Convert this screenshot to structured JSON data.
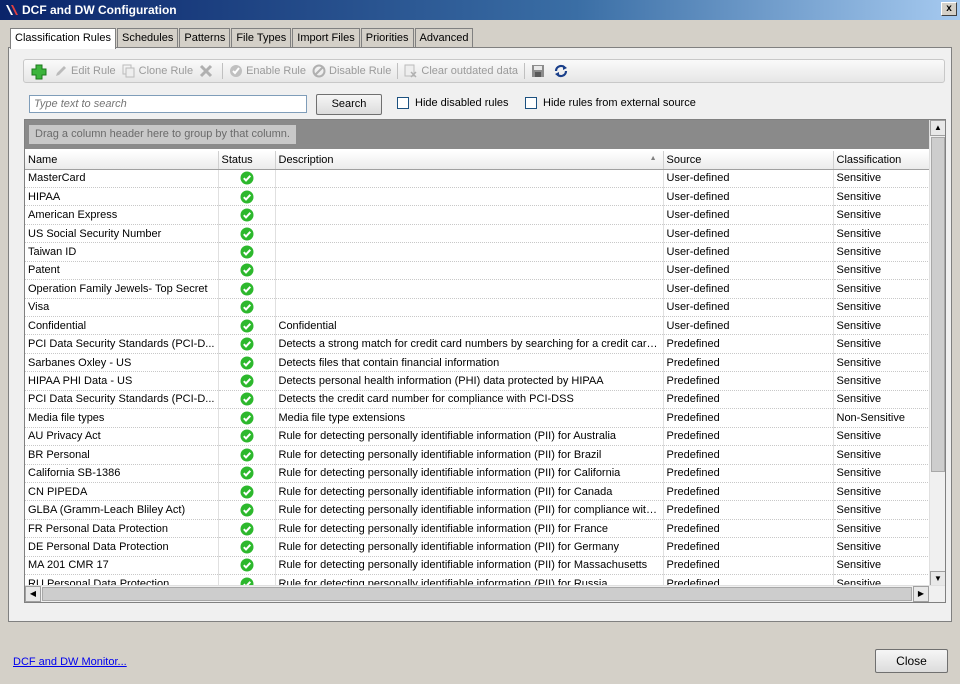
{
  "window": {
    "title": "DCF and DW Configuration",
    "close_label": "x"
  },
  "tabs": [
    {
      "label": "Classification Rules",
      "active": true
    },
    {
      "label": "Schedules",
      "active": false
    },
    {
      "label": "Patterns",
      "active": false
    },
    {
      "label": "File Types",
      "active": false
    },
    {
      "label": "Import Files",
      "active": false
    },
    {
      "label": "Priorities",
      "active": false
    },
    {
      "label": "Advanced",
      "active": false
    }
  ],
  "toolbar": {
    "add_icon": "plus-icon",
    "edit_label": "Edit Rule",
    "clone_label": "Clone Rule",
    "delete_icon": "delete-x-icon",
    "enable_label": "Enable Rule",
    "disable_label": "Disable Rule",
    "clear_label": "Clear outdated data",
    "save_icon": "save-icon",
    "refresh_icon": "refresh-icon"
  },
  "search": {
    "placeholder": "Type text to search",
    "button_label": "Search",
    "hide_disabled_label": "Hide disabled rules",
    "hide_external_label": "Hide rules from external source"
  },
  "grid": {
    "group_hint": "Drag a column header here to group by that column.",
    "columns": [
      "Name",
      "Status",
      "Description",
      "Source",
      "Classification"
    ],
    "rows": [
      {
        "name": "MasterCard",
        "description": "",
        "source": "User-defined",
        "classification": "Sensitive"
      },
      {
        "name": "HIPAA",
        "description": "",
        "source": "User-defined",
        "classification": "Sensitive"
      },
      {
        "name": "American Express",
        "description": "",
        "source": "User-defined",
        "classification": "Sensitive"
      },
      {
        "name": "US Social Security Number",
        "description": "",
        "source": "User-defined",
        "classification": "Sensitive"
      },
      {
        "name": "Taiwan ID",
        "description": "",
        "source": "User-defined",
        "classification": "Sensitive"
      },
      {
        "name": "Patent",
        "description": "",
        "source": "User-defined",
        "classification": "Sensitive"
      },
      {
        "name": "Operation Family Jewels- Top Secret",
        "description": "",
        "source": "User-defined",
        "classification": "Sensitive"
      },
      {
        "name": "Visa",
        "description": "",
        "source": "User-defined",
        "classification": "Sensitive"
      },
      {
        "name": "Confidential",
        "description": "Confidential",
        "source": "User-defined",
        "classification": "Sensitive"
      },
      {
        "name": "PCI Data Security Standards (PCI-D...",
        "description": "Detects a strong match for credit card numbers by searching for a credit card...",
        "source": "Predefined",
        "classification": "Sensitive"
      },
      {
        "name": "Sarbanes Oxley - US",
        "description": "Detects files that contain financial information",
        "source": "Predefined",
        "classification": "Sensitive"
      },
      {
        "name": "HIPAA PHI Data - US",
        "description": "Detects personal health information (PHI) data protected by HIPAA",
        "source": "Predefined",
        "classification": "Sensitive"
      },
      {
        "name": "PCI Data Security Standards (PCI-D...",
        "description": "Detects the credit card number for compliance with PCI-DSS",
        "source": "Predefined",
        "classification": "Sensitive"
      },
      {
        "name": "Media file types",
        "description": "Media file type extensions",
        "source": "Predefined",
        "classification": "Non-Sensitive"
      },
      {
        "name": "AU Privacy Act",
        "description": "Rule for detecting personally identifiable information (PII) for Australia",
        "source": "Predefined",
        "classification": "Sensitive"
      },
      {
        "name": "BR Personal",
        "description": "Rule for detecting personally identifiable information (PII) for Brazil",
        "source": "Predefined",
        "classification": "Sensitive"
      },
      {
        "name": "California SB-1386",
        "description": "Rule for detecting personally identifiable information (PII) for California",
        "source": "Predefined",
        "classification": "Sensitive"
      },
      {
        "name": "CN PIPEDA",
        "description": "Rule for detecting personally identifiable information (PII) for Canada",
        "source": "Predefined",
        "classification": "Sensitive"
      },
      {
        "name": "GLBA (Gramm-Leach Bliley Act)",
        "description": "Rule for detecting personally identifiable information (PII) for compliance with...",
        "source": "Predefined",
        "classification": "Sensitive"
      },
      {
        "name": "FR Personal Data Protection",
        "description": "Rule for detecting personally identifiable information (PII) for France",
        "source": "Predefined",
        "classification": "Sensitive"
      },
      {
        "name": "DE Personal Data Protection",
        "description": "Rule for detecting personally identifiable information (PII) for Germany",
        "source": "Predefined",
        "classification": "Sensitive"
      },
      {
        "name": "MA 201 CMR 17",
        "description": "Rule for detecting personally identifiable information (PII) for Massachusetts",
        "source": "Predefined",
        "classification": "Sensitive"
      },
      {
        "name": "RU Personal Data Protection",
        "description": "Rule for detecting personally identifiable information (PII) for Russia",
        "source": "Predefined",
        "classification": "Sensitive"
      }
    ]
  },
  "status_icon": "enabled-check-icon",
  "colors": {
    "status_green": "#2db82d",
    "title_blue": "#0a246a",
    "link": "#0000ee"
  },
  "footer": {
    "monitor_link": "DCF and DW Monitor...",
    "close_label": "Close"
  }
}
